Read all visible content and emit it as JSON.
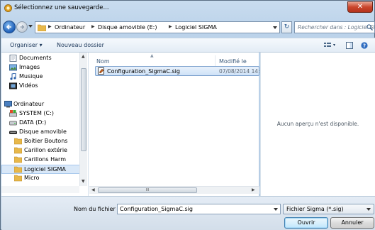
{
  "window": {
    "title": "Sélectionnez une sauvegarde..."
  },
  "address_bar": {
    "breadcrumbs": [
      "Ordinateur",
      "Disque amovible (E:)",
      "Logiciel SIGMA"
    ]
  },
  "search": {
    "placeholder": "Rechercher dans : Logiciel SIG..."
  },
  "toolbar": {
    "organize_label": "Organiser ▾",
    "new_folder_label": "Nouveau dossier"
  },
  "nav_pane": {
    "items": [
      {
        "label": "Documents",
        "icon": "documents-icon"
      },
      {
        "label": "Images",
        "icon": "images-icon"
      },
      {
        "label": "Musique",
        "icon": "music-icon"
      },
      {
        "label": "Vidéos",
        "icon": "videos-icon"
      },
      {
        "label": "Ordinateur",
        "icon": "computer-icon"
      },
      {
        "label": "SYSTEM (C:)",
        "icon": "system-drive-icon"
      },
      {
        "label": "DATA (D:)",
        "icon": "drive-icon"
      },
      {
        "label": "Disque amovible",
        "icon": "removable-drive-icon"
      },
      {
        "label": "Boitier Boutons",
        "icon": "folder-icon"
      },
      {
        "label": "Carillon extérie",
        "icon": "folder-icon"
      },
      {
        "label": "Carillons Harm",
        "icon": "folder-icon"
      },
      {
        "label": "Logiciel SIGMA",
        "icon": "folder-icon"
      },
      {
        "label": "Micro",
        "icon": "folder-icon"
      }
    ]
  },
  "file_list": {
    "columns": {
      "name": "Nom",
      "modified": "Modifié le"
    },
    "files": [
      {
        "name": "Configuration_SigmaC.sig",
        "modified": "07/08/2014 14:5"
      }
    ]
  },
  "preview": {
    "message": "Aucun aperçu n'est disponible."
  },
  "footer": {
    "filename_label": "Nom du fichier :",
    "filename_value": "Configuration_SigmaC.sig",
    "filetype_value": "Fichier Sigma (*.sig)",
    "open_label": "Ouvrir",
    "cancel_label": "Annuler"
  },
  "colors": {
    "accent": "#1e5fb8",
    "selection": "#cfe2f7",
    "folder": "#e8b84a"
  }
}
